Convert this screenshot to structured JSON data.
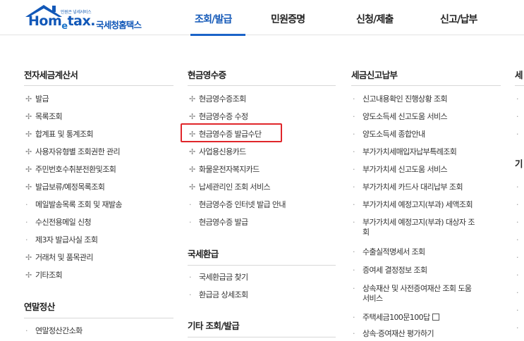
{
  "brand": {
    "tagline": "민원은 넣세서비스",
    "name_left": "Hom",
    "name_e": "e",
    "name_right": "tax.",
    "name_kr": "국세청홈택스"
  },
  "gnb": {
    "items": [
      {
        "label": "조회/발급",
        "active": true
      },
      {
        "label": "민원증명",
        "active": false
      },
      {
        "label": "신청/제출",
        "active": false
      },
      {
        "label": "신고/납부",
        "active": false
      }
    ]
  },
  "columns": {
    "c1": {
      "title": "전자세금계산서",
      "items": [
        "발급",
        "목록조회",
        "합계표 및 통계조회",
        "사용자유형별 조회권한 관리",
        "주민번호수취분전환및조회",
        "발급보류/예정목록조회",
        "메일발송목록 조회 및 재발송",
        "수신전용메일 신청",
        "제3자 발급사실 조회",
        "거래처 및 품목관리",
        "기타조회"
      ],
      "sub_title": "연말정산",
      "sub_items": [
        "연말정산간소화"
      ]
    },
    "c2": {
      "title": "현금영수증",
      "items": [
        "현금영수증조회",
        "현금영수증 수정",
        "현금영수증 발급수단",
        "사업용신용카드",
        "화물운전자복지카드",
        "납세관리인 조회 서비스",
        "현금영수증 인터넷 발급 안내",
        "현금영수증 발급"
      ],
      "sub_title": "국세환급",
      "sub_items": [
        "국세환급금 찾기",
        "환급금 상세조회"
      ],
      "sub_title2": "기타 조회/발급"
    },
    "c3": {
      "title": "세금신고납부",
      "items": [
        "신고내용확인 진행상황 조회",
        "양도소득세 신고도움 서비스",
        "양도소득세 종합안내",
        "부가가치세매입자납부특례조회",
        "부가가치세 신고도움 서비스",
        "부가가치세 카드사 대리납부 조회",
        "부가가치세 예정고지(부과) 세액조회",
        "부가가치세 예정고지(부과) 대상자 조",
        "회",
        "수출실적명세서 조회",
        "증여세 결정정보 조회",
        "상속재산 및 사전증여재산 조회 도움",
        "서비스",
        "주택세금100문100답",
        "상속·증여재산 평가하기"
      ]
    },
    "c4": {
      "title": "세",
      "sub_title": "기"
    }
  },
  "icons": {
    "bullet_cross": "✢",
    "bullet_dot": "·"
  },
  "colors": {
    "brand_blue": "#1258b8",
    "highlight_red": "#e0262b"
  }
}
